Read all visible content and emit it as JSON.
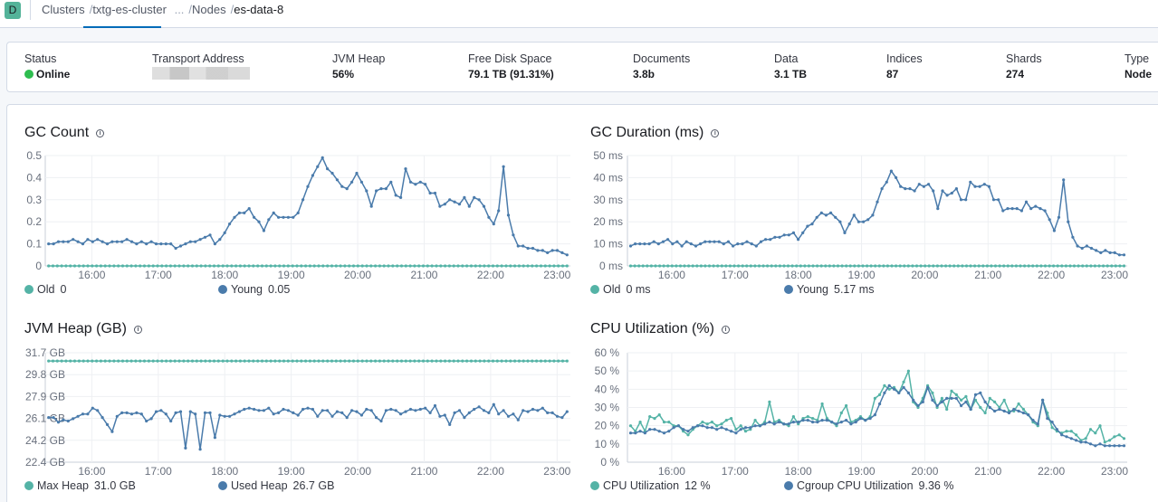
{
  "app_badge": "D",
  "breadcrumb": {
    "clusters": "Clusters",
    "cluster": "txtg-es-cluster",
    "ellipsis": "...",
    "nodes": "Nodes",
    "current": "es-data-8"
  },
  "status": {
    "status_label": "Status",
    "status_value": "Online",
    "transport_label": "Transport Address",
    "jvm_heap_label": "JVM Heap",
    "jvm_heap_value": "56%",
    "free_disk_label": "Free Disk Space",
    "free_disk_value": "79.1 TB (91.31%)",
    "documents_label": "Documents",
    "documents_value": "3.8b",
    "data_label": "Data",
    "data_value": "3.1 TB",
    "indices_label": "Indices",
    "indices_value": "87",
    "shards_label": "Shards",
    "shards_value": "274",
    "type_label": "Type",
    "type_value": "Node"
  },
  "colors": {
    "teal": "#54b3a6",
    "blue": "#4a7bab",
    "online": "#2ebd4f"
  },
  "charts": {
    "gc_count": {
      "title": "GC Count",
      "legend": [
        {
          "name": "Old",
          "value": "0"
        },
        {
          "name": "Young",
          "value": "0.05"
        }
      ]
    },
    "gc_duration": {
      "title": "GC Duration (ms)",
      "legend": [
        {
          "name": "Old",
          "value": "0 ms"
        },
        {
          "name": "Young",
          "value": "5.17 ms"
        }
      ]
    },
    "jvm_heap": {
      "title": "JVM Heap (GB)",
      "legend": [
        {
          "name": "Max Heap",
          "value": "31.0 GB"
        },
        {
          "name": "Used Heap",
          "value": "26.7 GB"
        }
      ]
    },
    "cpu": {
      "title": "CPU Utilization (%)",
      "legend": [
        {
          "name": "CPU Utilization",
          "value": "12 %"
        },
        {
          "name": "Cgroup CPU Utilization",
          "value": "9.36 %"
        }
      ]
    }
  },
  "chart_data": [
    {
      "type": "line",
      "title": "GC Count",
      "x_ticks": [
        "16:00",
        "17:00",
        "18:00",
        "19:00",
        "20:00",
        "21:00",
        "22:00",
        "23:00"
      ],
      "y_ticks": [
        "0",
        "0.1",
        "0.2",
        "0.3",
        "0.4",
        "0.5"
      ],
      "ylim": [
        0,
        0.5
      ],
      "x_range_hours": [
        15.3,
        23.2
      ],
      "series": [
        {
          "name": "Old",
          "color": "#54b3a6",
          "y": [
            0,
            0
          ]
        },
        {
          "name": "Young",
          "color": "#4a7bab",
          "y": [
            0.1,
            0.1,
            0.11,
            0.11,
            0.11,
            0.12,
            0.11,
            0.1,
            0.12,
            0.11,
            0.12,
            0.11,
            0.1,
            0.11,
            0.11,
            0.11,
            0.12,
            0.11,
            0.1,
            0.11,
            0.1,
            0.11,
            0.1,
            0.1,
            0.1,
            0.1,
            0.08,
            0.09,
            0.1,
            0.11,
            0.11,
            0.12,
            0.13,
            0.14,
            0.1,
            0.12,
            0.15,
            0.19,
            0.22,
            0.24,
            0.24,
            0.26,
            0.22,
            0.2,
            0.16,
            0.21,
            0.24,
            0.22,
            0.22,
            0.22,
            0.22,
            0.24,
            0.3,
            0.36,
            0.41,
            0.45,
            0.49,
            0.44,
            0.42,
            0.39,
            0.36,
            0.35,
            0.38,
            0.42,
            0.38,
            0.34,
            0.27,
            0.34,
            0.35,
            0.35,
            0.38,
            0.32,
            0.31,
            0.44,
            0.38,
            0.37,
            0.38,
            0.37,
            0.33,
            0.33,
            0.27,
            0.28,
            0.3,
            0.29,
            0.28,
            0.31,
            0.27,
            0.31,
            0.3,
            0.27,
            0.22,
            0.19,
            0.25,
            0.45,
            0.23,
            0.14,
            0.09,
            0.09,
            0.08,
            0.08,
            0.07,
            0.07,
            0.06,
            0.07,
            0.07,
            0.06,
            0.05
          ]
        }
      ]
    },
    {
      "type": "line",
      "title": "GC Duration (ms)",
      "x_ticks": [
        "16:00",
        "17:00",
        "18:00",
        "19:00",
        "20:00",
        "21:00",
        "22:00",
        "23:00"
      ],
      "y_ticks": [
        "0 ms",
        "10 ms",
        "20 ms",
        "30 ms",
        "40 ms",
        "50 ms"
      ],
      "ylim": [
        0,
        50
      ],
      "x_range_hours": [
        15.3,
        23.2
      ],
      "series": [
        {
          "name": "Old",
          "color": "#54b3a6",
          "y": [
            0,
            0
          ]
        },
        {
          "name": "Young",
          "color": "#4a7bab",
          "y": [
            9,
            10,
            10,
            10,
            10,
            11,
            10,
            11,
            12,
            10,
            11,
            9,
            11,
            10,
            9,
            10,
            11,
            11,
            11,
            11,
            10,
            11,
            9,
            10,
            10,
            11,
            10,
            9,
            11,
            12,
            12,
            13,
            13,
            14,
            14,
            15,
            12,
            15,
            18,
            19,
            22,
            24,
            23,
            24,
            22,
            20,
            15,
            19,
            23,
            20,
            20,
            21,
            23,
            29,
            35,
            38,
            43,
            40,
            36,
            35,
            35,
            34,
            37,
            36,
            37,
            34,
            26,
            34,
            32,
            33,
            35,
            30,
            30,
            38,
            36,
            36,
            37,
            36,
            30,
            30,
            25,
            26,
            26,
            26,
            25,
            29,
            26,
            27,
            26,
            25,
            21,
            16,
            22,
            39,
            20,
            13,
            9,
            8,
            9,
            8,
            7,
            6,
            7,
            6,
            6,
            5,
            5
          ]
        }
      ]
    },
    {
      "type": "line",
      "title": "JVM Heap (GB)",
      "x_ticks": [
        "16:00",
        "17:00",
        "18:00",
        "19:00",
        "20:00",
        "21:00",
        "22:00",
        "23:00"
      ],
      "y_ticks": [
        "22.4 GB",
        "24.2 GB",
        "26.1 GB",
        "27.9 GB",
        "29.8 GB",
        "31.7 GB"
      ],
      "ylim": [
        22.4,
        31.7
      ],
      "x_range_hours": [
        15.3,
        23.2
      ],
      "series": [
        {
          "name": "Max Heap",
          "color": "#54b3a6",
          "y": [
            31.0,
            31.0
          ]
        },
        {
          "name": "Used Heap",
          "color": "#4a7bab",
          "y": [
            26.2,
            26.2,
            25.8,
            26.0,
            25.9,
            26.1,
            26.3,
            26.5,
            26.5,
            27.0,
            26.8,
            26.2,
            25.6,
            25.0,
            26.3,
            26.6,
            26.6,
            26.5,
            26.6,
            26.5,
            25.9,
            26.1,
            26.7,
            26.8,
            26.5,
            25.9,
            26.6,
            26.7,
            23.6,
            26.7,
            26.5,
            23.5,
            26.6,
            26.6,
            24.5,
            26.4,
            26.3,
            26.3,
            26.5,
            26.7,
            26.9,
            27.0,
            26.9,
            26.8,
            26.8,
            27.0,
            26.5,
            26.6,
            26.9,
            26.8,
            26.6,
            26.4,
            26.9,
            27.0,
            26.9,
            26.3,
            26.8,
            26.8,
            26.3,
            26.7,
            26.6,
            26.2,
            26.8,
            26.7,
            26.4,
            26.9,
            26.8,
            26.2,
            25.9,
            26.8,
            26.9,
            26.8,
            26.5,
            26.7,
            26.9,
            26.8,
            26.9,
            27.0,
            26.6,
            27.2,
            26.3,
            26.4,
            25.6,
            26.6,
            26.8,
            26.2,
            26.6,
            26.9,
            27.1,
            26.8,
            26.6,
            27.3,
            26.5,
            26.8,
            26.3,
            26.5,
            26.0,
            26.8,
            26.7,
            26.9,
            26.8,
            27.0,
            26.6,
            26.6,
            26.3,
            26.2,
            26.7
          ]
        }
      ]
    },
    {
      "type": "line",
      "title": "CPU Utilization (%)",
      "x_ticks": [
        "16:00",
        "17:00",
        "18:00",
        "19:00",
        "20:00",
        "21:00",
        "22:00",
        "23:00"
      ],
      "y_ticks": [
        "0 %",
        "10 %",
        "20 %",
        "30 %",
        "40 %",
        "50 %",
        "60 %"
      ],
      "ylim": [
        0,
        60
      ],
      "x_range_hours": [
        15.3,
        23.2
      ],
      "series": [
        {
          "name": "CPU Utilization",
          "color": "#54b3a6",
          "y": [
            20,
            17,
            22,
            17,
            25,
            24,
            26,
            22,
            22,
            20,
            20,
            17,
            15,
            18,
            20,
            22,
            21,
            22,
            20,
            21,
            23,
            24,
            18,
            20,
            17,
            18,
            23,
            20,
            22,
            33,
            22,
            23,
            21,
            20,
            25,
            21,
            24,
            25,
            24,
            23,
            32,
            24,
            22,
            20,
            27,
            31,
            22,
            23,
            25,
            23,
            25,
            35,
            37,
            42,
            40,
            41,
            38,
            44,
            50,
            33,
            30,
            35,
            42,
            38,
            30,
            35,
            29,
            39,
            37,
            34,
            36,
            29,
            34,
            30,
            27,
            35,
            33,
            30,
            34,
            28,
            28,
            32,
            29,
            26,
            22,
            20,
            34,
            27,
            19,
            17,
            16,
            17,
            17,
            15,
            12,
            13,
            18,
            16,
            20,
            11,
            12,
            14,
            15,
            13
          ]
        },
        {
          "name": "Cgroup CPU Utilization",
          "color": "#4a7bab",
          "y": [
            16,
            16,
            17,
            16,
            18,
            18,
            17,
            16,
            17,
            19,
            20,
            18,
            17,
            19,
            20,
            20,
            19,
            19,
            18,
            19,
            18,
            17,
            16,
            18,
            19,
            19,
            20,
            20,
            21,
            22,
            21,
            22,
            21,
            21,
            22,
            22,
            23,
            23,
            22,
            22,
            23,
            23,
            22,
            21,
            22,
            23,
            21,
            22,
            24,
            23,
            24,
            26,
            32,
            38,
            42,
            40,
            38,
            41,
            38,
            34,
            31,
            33,
            41,
            34,
            31,
            33,
            35,
            35,
            35,
            31,
            33,
            29,
            37,
            38,
            33,
            30,
            28,
            29,
            28,
            27,
            29,
            28,
            27,
            26,
            23,
            21,
            34,
            24,
            22,
            18,
            15,
            14,
            13,
            12,
            11,
            11,
            10,
            9,
            10,
            9,
            9,
            9,
            9,
            9
          ]
        }
      ]
    }
  ]
}
